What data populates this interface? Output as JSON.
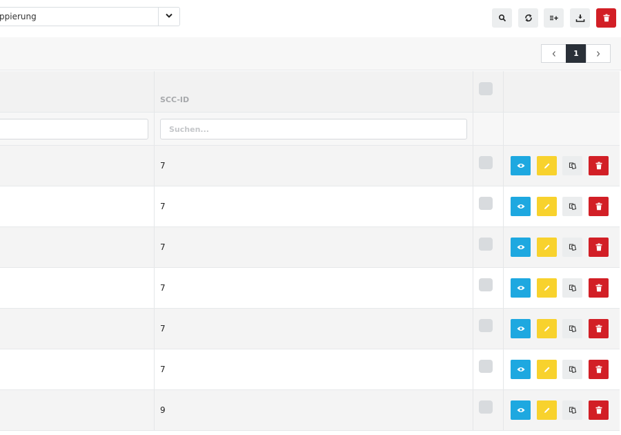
{
  "toolbar": {
    "grouping_value": "ppierung",
    "buttons": [
      {
        "name": "search",
        "icon": "search-icon"
      },
      {
        "name": "refresh",
        "icon": "refresh-icon"
      },
      {
        "name": "add-column",
        "icon": "add-list-icon"
      },
      {
        "name": "export",
        "icon": "download-icon"
      },
      {
        "name": "delete-all",
        "icon": "trash-icon"
      }
    ]
  },
  "pagination": {
    "current_page": "1"
  },
  "table": {
    "columns": [
      "",
      "SCC-ID"
    ],
    "filter_placeholder": "Suchen...",
    "rows": [
      {
        "scc_id": "7"
      },
      {
        "scc_id": "7"
      },
      {
        "scc_id": "7"
      },
      {
        "scc_id": "7"
      },
      {
        "scc_id": "7"
      },
      {
        "scc_id": "7"
      },
      {
        "scc_id": "9"
      }
    ]
  },
  "colors": {
    "view": "#1ea8e0",
    "edit": "#f8d22d",
    "copy": "#ebedee",
    "delete": "#d21f26",
    "active_page": "#2a3038"
  }
}
